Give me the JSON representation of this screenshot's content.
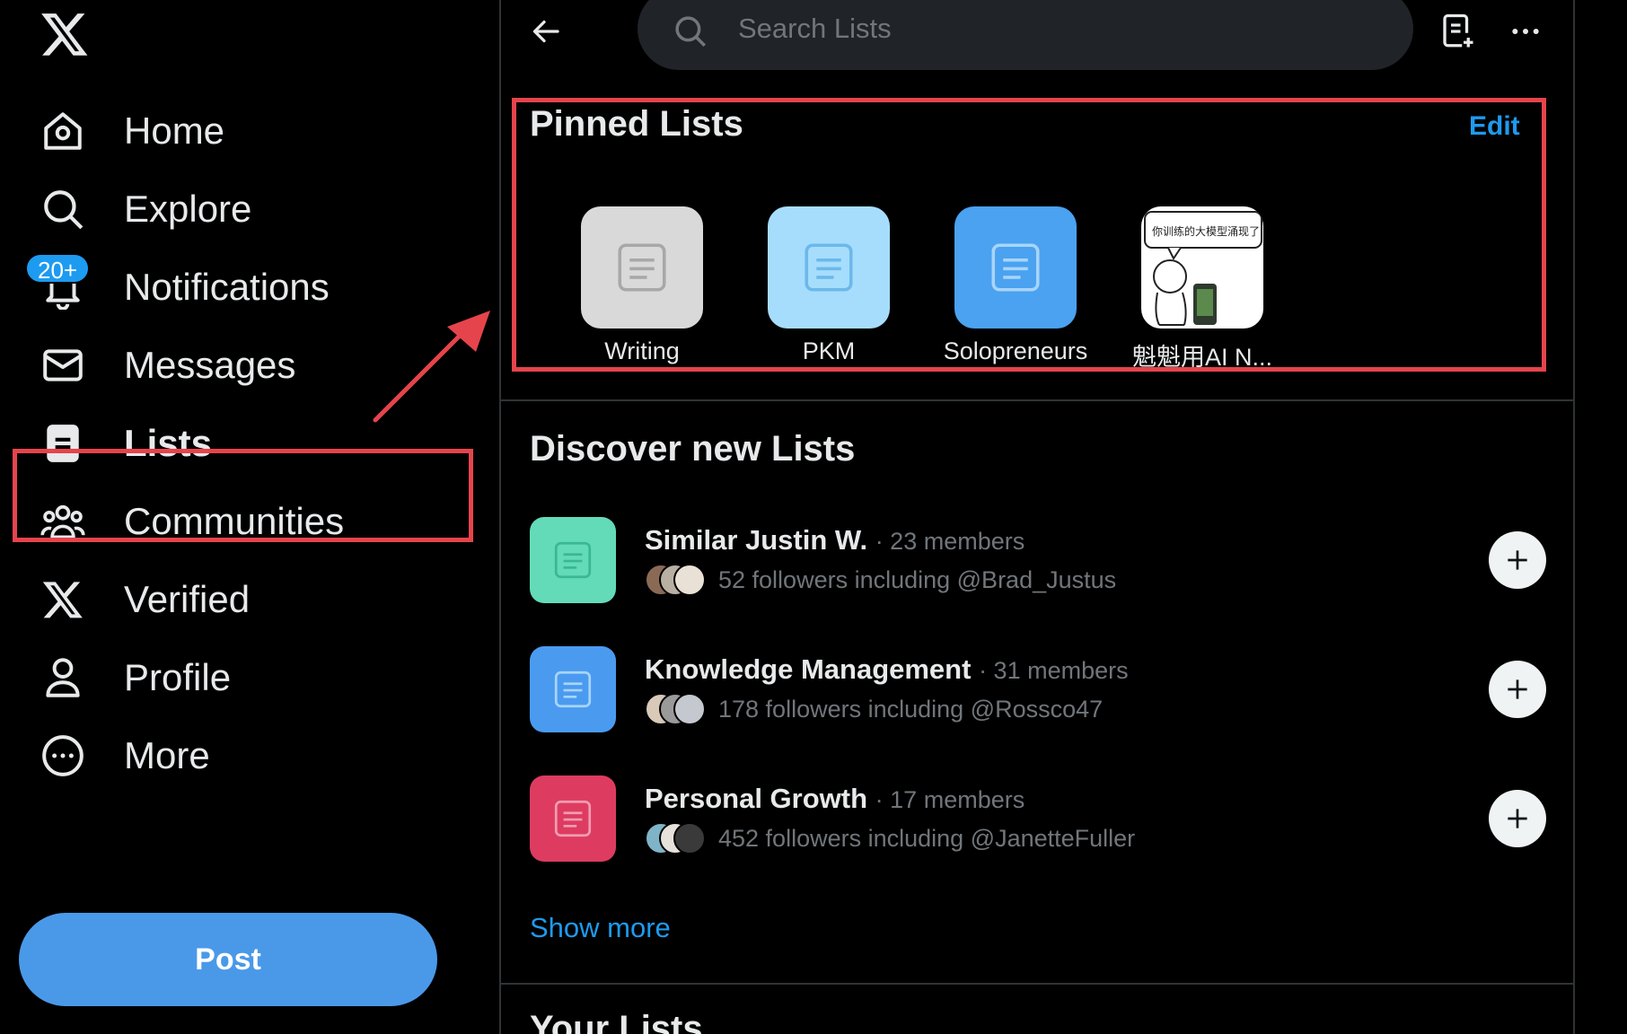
{
  "sidebar": {
    "logo_icon": "x-logo-icon",
    "items": [
      {
        "label": "Home",
        "icon": "home-icon"
      },
      {
        "label": "Explore",
        "icon": "search-icon"
      },
      {
        "label": "Notifications",
        "icon": "bell-icon",
        "badge": "20+"
      },
      {
        "label": "Messages",
        "icon": "envelope-icon"
      },
      {
        "label": "Lists",
        "icon": "lists-icon",
        "active": true
      },
      {
        "label": "Communities",
        "icon": "communities-icon"
      },
      {
        "label": "Verified",
        "icon": "x-logo-icon"
      },
      {
        "label": "Profile",
        "icon": "person-icon"
      },
      {
        "label": "More",
        "icon": "more-circle-icon"
      }
    ],
    "post_label": "Post"
  },
  "topbar": {
    "search_placeholder": "Search Lists"
  },
  "pinned": {
    "title": "Pinned Lists",
    "edit_label": "Edit",
    "lists": [
      {
        "label": "Writing",
        "color": "#d9d9d9"
      },
      {
        "label": "PKM",
        "color": "#a6ddfd"
      },
      {
        "label": "Solopreneurs",
        "color": "#4aa2f0"
      },
      {
        "label": "魁魁用AI N...",
        "image_text": "你训练的大模型涌现了"
      }
    ]
  },
  "discover": {
    "title": "Discover new Lists",
    "lists": [
      {
        "name": "Similar Justin W.",
        "members": "· 23 members",
        "followers": "52 followers including @Brad_Justus",
        "color": "#63dbb8"
      },
      {
        "name": "Knowledge Management",
        "members": "· 31 members",
        "followers": "178 followers including @Rossco47",
        "color": "#4a9bf0"
      },
      {
        "name": "Personal Growth",
        "members": "· 17 members",
        "followers": "452 followers including @JanetteFuller",
        "color": "#de3b61"
      }
    ],
    "show_more": "Show more"
  },
  "your_lists": {
    "title": "Your Lists"
  },
  "colors": {
    "accent": "#1d9bf0",
    "annotation": "#e5444c",
    "background": "#000000"
  }
}
